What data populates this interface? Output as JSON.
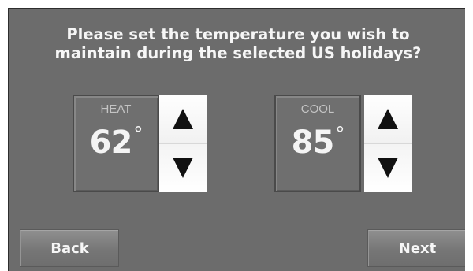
{
  "prompt": {
    "line1": "Please set the temperature you wish to",
    "line2": "maintain during the selected US holidays?"
  },
  "heat": {
    "label": "HEAT",
    "value": "62",
    "unit": "°",
    "up_icon": "triangle-up-icon",
    "down_icon": "triangle-down-icon"
  },
  "cool": {
    "label": "COOL",
    "value": "85",
    "unit": "°",
    "up_icon": "triangle-up-icon",
    "down_icon": "triangle-down-icon"
  },
  "buttons": {
    "back": "Back",
    "next": "Next"
  },
  "colors": {
    "screen_bg": "#6c6c6c",
    "panel_bg": "#6f6f6f",
    "stepper_bg": "#ffffff",
    "arrow": "#111111",
    "text": "#f6f6f6"
  }
}
